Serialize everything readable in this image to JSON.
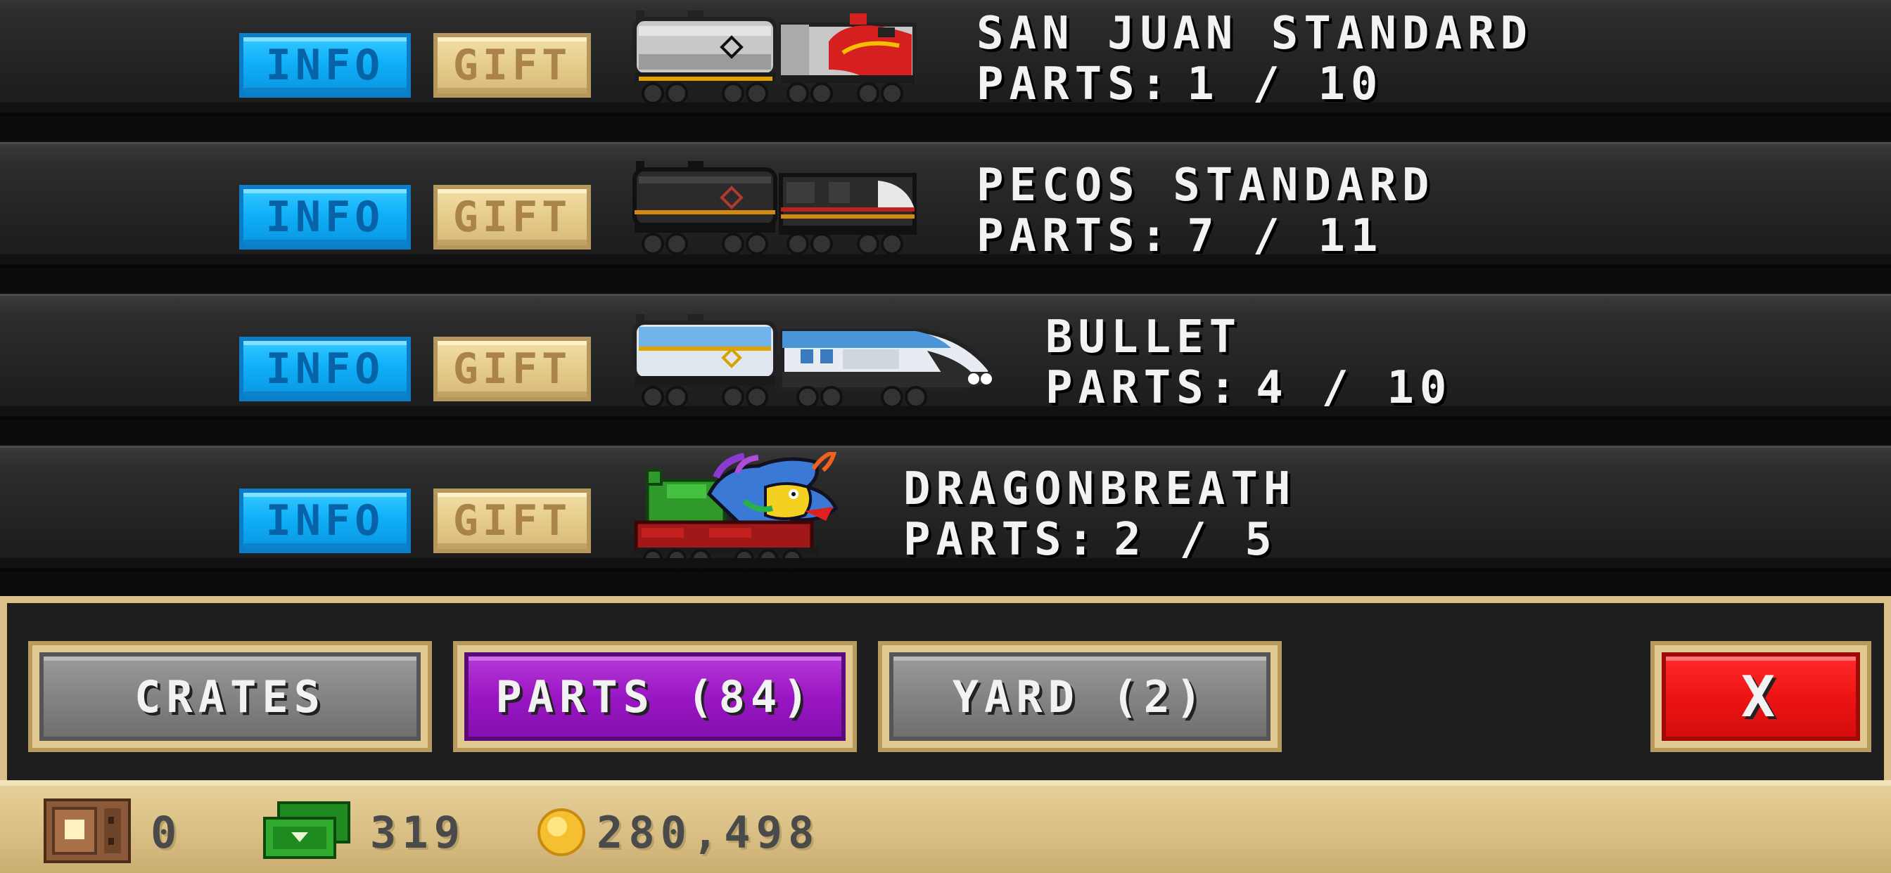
{
  "trains": [
    {
      "name": "SAN JUAN STANDARD",
      "parts_label": "PARTS:",
      "parts_value": "1 / 10",
      "info_label": "INFO",
      "gift_label": "GIFT",
      "icon": "tank-car-and-red-diesel-locomotive"
    },
    {
      "name": "PECOS STANDARD",
      "parts_label": "PARTS:",
      "parts_value": "7 / 11",
      "info_label": "INFO",
      "gift_label": "GIFT",
      "icon": "tank-car-and-black-diesel-locomotive"
    },
    {
      "name": "BULLET",
      "parts_label": "PARTS:",
      "parts_value": "4 / 10",
      "info_label": "INFO",
      "gift_label": "GIFT",
      "icon": "tank-car-and-bullet-train"
    },
    {
      "name": "DRAGONBREATH",
      "parts_label": "PARTS:",
      "parts_value": "2 / 5",
      "info_label": "INFO",
      "gift_label": "GIFT",
      "icon": "dragon-locomotive"
    }
  ],
  "tabs": {
    "crates": "CRATES",
    "parts": "PARTS (84)",
    "yard": "YARD (2)",
    "close": "X"
  },
  "currency": {
    "crates_count": "0",
    "cash": "319",
    "coins": "280,498"
  },
  "colors": {
    "info_button": "#0fb0f8",
    "gift_button": "#e6cc8a",
    "active_tab": "#9a16c4",
    "inactive_tab": "#848484",
    "close_button": "#ee1414",
    "panel_border": "#d9c08a"
  }
}
